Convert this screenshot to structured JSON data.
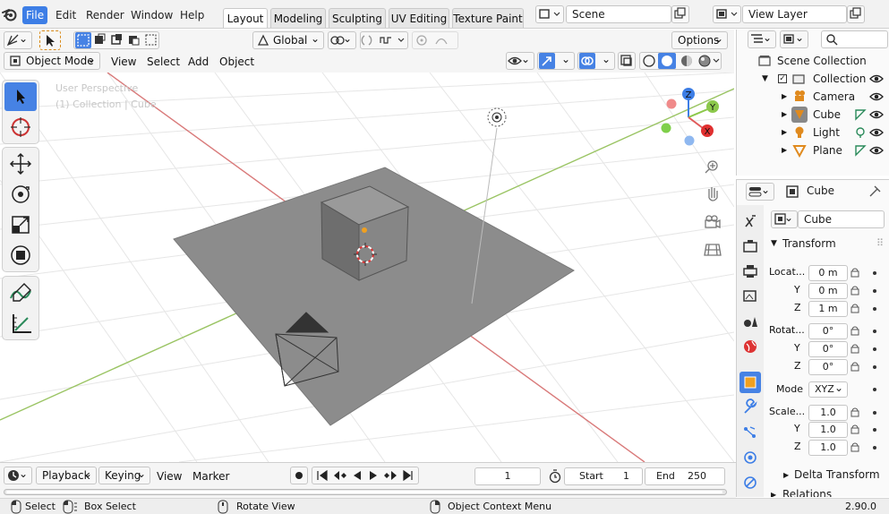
{
  "menu": {
    "items": [
      "File",
      "Edit",
      "Render",
      "Window",
      "Help"
    ]
  },
  "workspaces": [
    "Layout",
    "Modeling",
    "Sculpting",
    "UV Editing",
    "Texture Paint"
  ],
  "scene": {
    "name": "Scene",
    "view_layer": "View Layer"
  },
  "viewport_header": {
    "transform_orientation": "Global",
    "options_label": "Options",
    "mode": "Object Mode",
    "menus": [
      "View",
      "Select",
      "Add",
      "Object"
    ]
  },
  "viewport": {
    "overlay_title": "User Perspective",
    "overlay_subtitle": "(1) Collection | Cube",
    "gizmo_axes": {
      "x": "X",
      "y": "Y",
      "z": "Z"
    }
  },
  "outliner": {
    "root": "Scene Collection",
    "collection": "Collection",
    "objects": [
      "Camera",
      "Cube",
      "Light",
      "Plane"
    ]
  },
  "properties": {
    "object_name": "Cube",
    "panel_transform": "Transform",
    "location_label": "Locat...",
    "location": {
      "x": "0 m",
      "y": "0 m",
      "z": "1 m"
    },
    "rotation_label": "Rotat...",
    "rotation": {
      "x": "0°",
      "y": "0°",
      "z": "0°"
    },
    "mode_label": "Mode",
    "mode_value": "XYZ",
    "scale_label": "Scale...",
    "scale": {
      "x": "1.0",
      "y": "1.0",
      "z": "1.0"
    },
    "axis_y": "Y",
    "axis_z": "Z",
    "delta_transform": "Delta Transform",
    "relations": "Relations"
  },
  "timeline": {
    "menus": [
      "Playback",
      "Keying",
      "View",
      "Marker"
    ],
    "current_frame": "1",
    "start_label": "Start",
    "start": "1",
    "end_label": "End",
    "end": "250"
  },
  "statusbar": {
    "select": "Select",
    "box_select": "Box Select",
    "rotate_view": "Rotate View",
    "context_menu": "Object Context Menu",
    "version": "2.90.0"
  },
  "colors": {
    "accent": "#4682e4",
    "axis_x": "#e05a5a",
    "axis_y": "#8cc84b",
    "axis_z": "#3d7ee6"
  }
}
